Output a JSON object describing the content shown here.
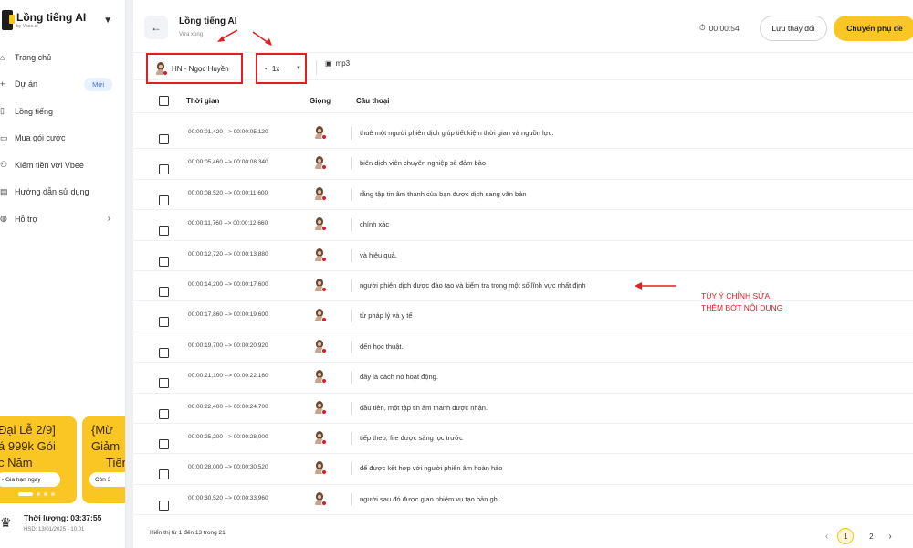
{
  "brand": {
    "name": "Lồng tiếng AI",
    "sub": "by Vbee.ai"
  },
  "sidebar": {
    "items": [
      {
        "label": "Trang chủ",
        "icon": "home-icon"
      },
      {
        "label": "Dự án",
        "icon": "plus-icon",
        "badge": "Mới"
      },
      {
        "label": "Lồng tiếng",
        "icon": "mic-icon"
      },
      {
        "label": "Mua gói cước",
        "icon": "cart-icon"
      },
      {
        "label": "Kiếm tiền với Vbee",
        "icon": "people-icon"
      },
      {
        "label": "Hướng dẫn sử dụng",
        "icon": "book-icon"
      },
      {
        "label": "Hỗ trợ",
        "icon": "support-icon",
        "arrow": "›"
      }
    ],
    "promo1": {
      "line1": "Đại Lễ 2/9]",
      "line2": "á 999k Gói",
      "line3": "c Năm",
      "button": "- Gia hạn ngay"
    },
    "promo2": {
      "line1": "{Mừ",
      "line2": "Giảm",
      "line3": "Tiến",
      "button": "Còn 3"
    },
    "duration": {
      "label": "Thời lượng: 03:37:55",
      "expiry": "HSD: 13/01/2025 - 10:01"
    }
  },
  "header": {
    "title": "Lồng tiếng AI",
    "subtitle": "Vừa xong",
    "timer": "00:00:54",
    "save_label": "Lưu thay đổi",
    "convert_label": "Chuyển phụ đề"
  },
  "toolbar": {
    "voice": "HN - Ngọc Huyền",
    "speed": "1x",
    "format": "mp3"
  },
  "table": {
    "columns": {
      "time": "Thời gian",
      "voice": "Giọng",
      "line": "Câu thoại"
    },
    "rows": [
      {
        "time": "00:00:01,420 --> 00:00:05,120",
        "text": "thuê một người phiên dịch giúp tiết kiệm thời gian và nguồn lực."
      },
      {
        "time": "00:00:05,460 --> 00:00:08,340",
        "text": "biên dịch viên chuyên nghiệp sẽ đảm bảo"
      },
      {
        "time": "00:00:08,520 --> 00:00:11,600",
        "text": "rằng tập tin âm thanh của bạn được dịch sang văn bản"
      },
      {
        "time": "00:00:11,760 --> 00:00:12,660",
        "text": "chính xác"
      },
      {
        "time": "00:00:12,720 --> 00:00:13,880",
        "text": "và hiệu quả."
      },
      {
        "time": "00:00:14,200 --> 00:00:17,600",
        "text": "người phiên dịch được đào tạo và kiểm tra trong một số lĩnh vực nhất định"
      },
      {
        "time": "00:00:17,860 --> 00:00:19,600",
        "text": "từ pháp lý và y tế"
      },
      {
        "time": "00:00:19,700 --> 00:00:20,920",
        "text": "đến học thuật."
      },
      {
        "time": "00:00:21,100 --> 00:00:22,160",
        "text": "đây là cách nó hoạt động."
      },
      {
        "time": "00:00:22,400 --> 00:00:24,700",
        "text": "đầu tiên, một tập tin âm thanh được nhận."
      },
      {
        "time": "00:00:25,200 --> 00:00:28,000",
        "text": "tiếp theo, file được sàng lọc trước"
      },
      {
        "time": "00:00:28,000 --> 00:00:30,520",
        "text": "để được kết hợp với người phiên âm hoàn hảo"
      },
      {
        "time": "00:00:30,520 --> 00:00:33,960",
        "text": "người sau đó được giao nhiệm vụ tạo bản ghi."
      }
    ]
  },
  "annotation": {
    "line1": "TÙY Ý CHỈNH SỬA",
    "line2": "THÊM BỚT NỘI DUNG"
  },
  "footer": {
    "showing": "Hiển thị từ 1 đến 13 trong 21",
    "pages": [
      "1",
      "2"
    ],
    "current_page": "1",
    "prev": "‹",
    "next": "›"
  },
  "colors": {
    "accent": "#f9c623",
    "annotation": "#e02020"
  }
}
